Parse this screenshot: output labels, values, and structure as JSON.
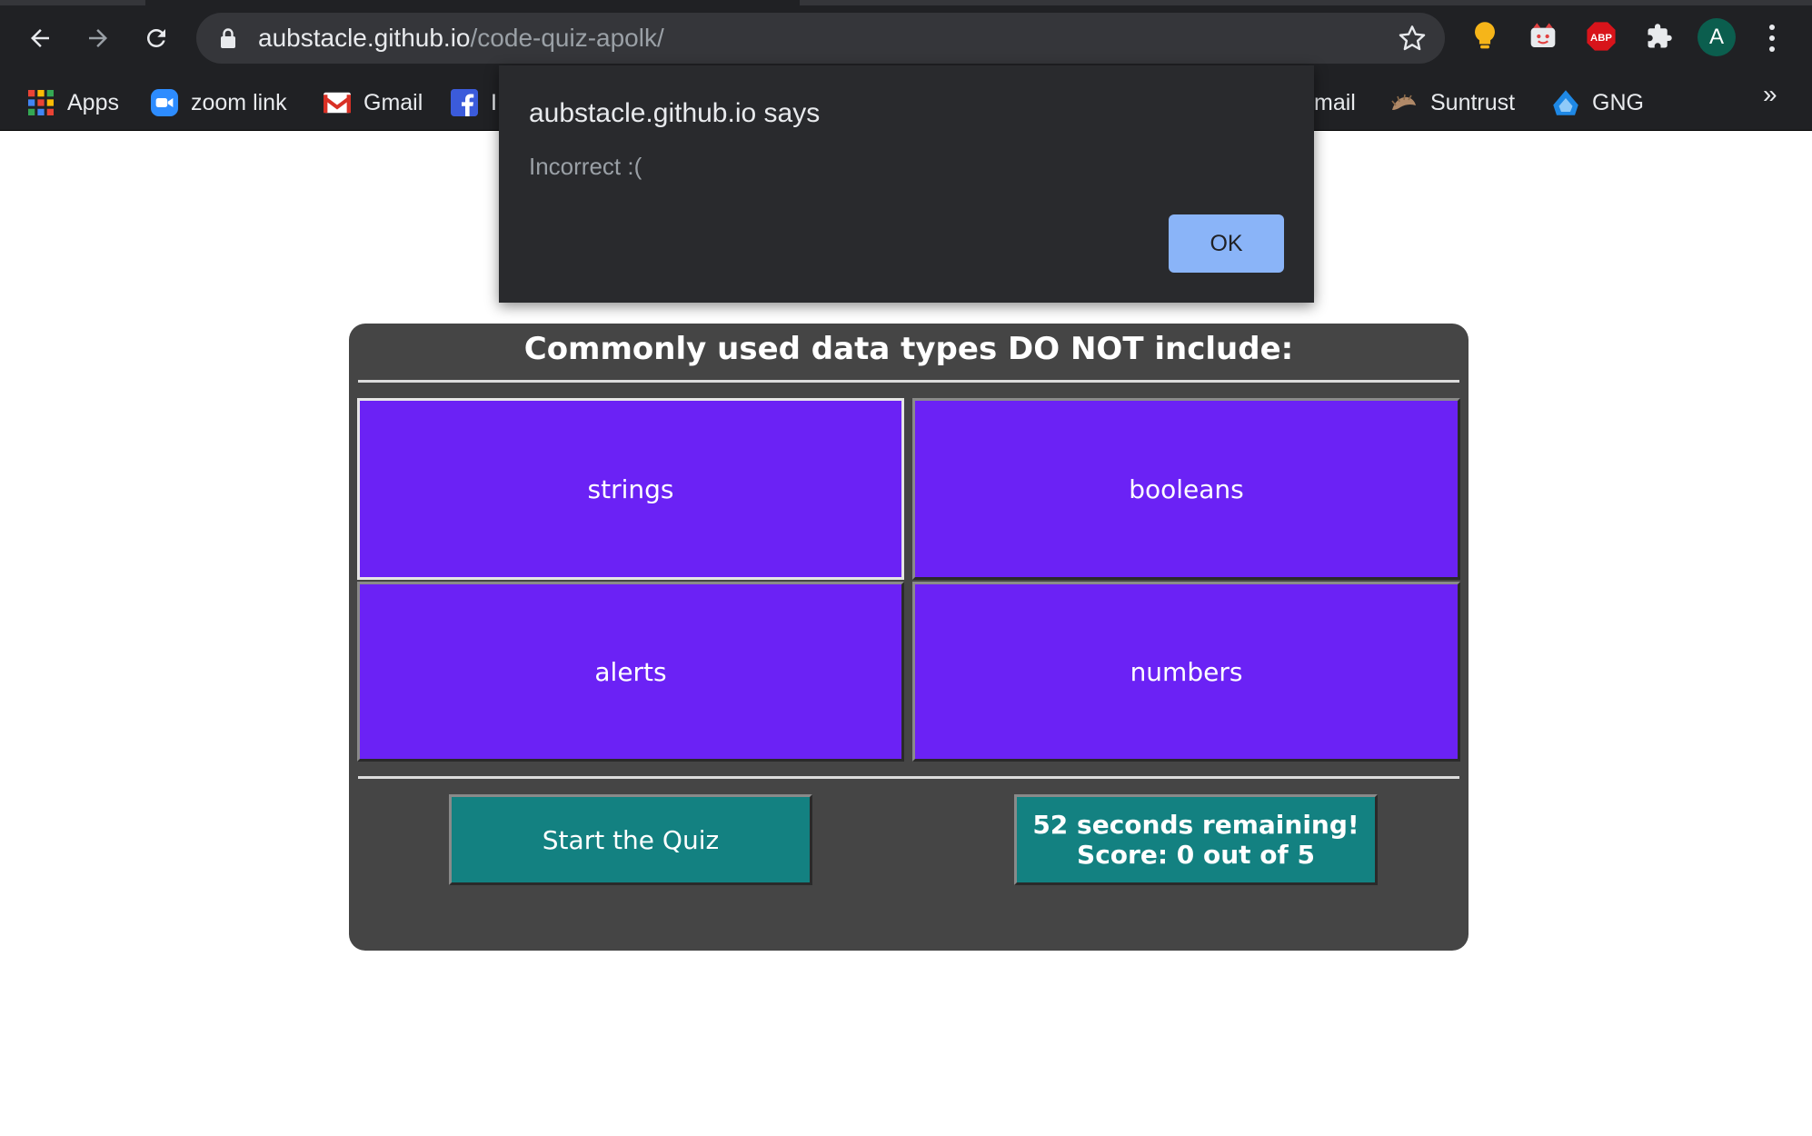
{
  "browser": {
    "url_host": "aubstacle.github.io",
    "url_path": "/code-quiz-apolk/",
    "avatar_letter": "A",
    "bookmarks": [
      {
        "label": "Apps",
        "icon": "apps-grid-icon"
      },
      {
        "label": "zoom link",
        "icon": "zoom-icon"
      },
      {
        "label": "Gmail",
        "icon": "gmail-icon"
      },
      {
        "label": "I",
        "icon": "facebook-icon"
      },
      {
        "label": "mail",
        "icon": ""
      },
      {
        "label": "Suntrust",
        "icon": "suntrust-icon"
      },
      {
        "label": "GNG",
        "icon": "gng-icon"
      }
    ],
    "overflow_label": "»"
  },
  "dialog": {
    "title": "aubstacle.github.io says",
    "message": "Incorrect :(",
    "ok_label": "OK"
  },
  "quiz": {
    "question": "Commonly used data types DO NOT include:",
    "answers": [
      "strings",
      "booleans",
      "alerts",
      "numbers"
    ],
    "start_label": "Start the Quiz",
    "status_line1": "52 seconds remaining!",
    "status_line2": "Score: 0 out of 5"
  },
  "colors": {
    "answer_bg": "#6b22f5",
    "action_bg": "#138181",
    "card_bg": "#454545",
    "dialog_bg": "#292a2d",
    "ok_bg": "#8ab4f8"
  }
}
